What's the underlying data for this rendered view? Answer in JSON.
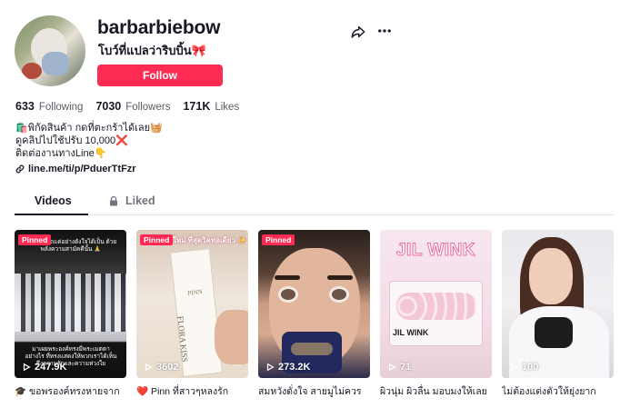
{
  "profile": {
    "username": "barbarbiebow",
    "subtitle": "โบว์ที่แปลว่าริบบิ้น🎀",
    "follow_label": "Follow"
  },
  "stats": [
    {
      "num": "633",
      "label": "Following"
    },
    {
      "num": "7030",
      "label": "Followers"
    },
    {
      "num": "171K",
      "label": "Likes"
    }
  ],
  "bio": {
    "lines": [
      "🛍️พิกัดสินค้า กดที่ตะกร้าได้เลย🧺",
      "ดูคลิปไปใช้ปรับ 10,000❌",
      "ติดต่องานทางLine👇"
    ],
    "link": "line.me/ti/p/PduerTtFzr"
  },
  "tabs": {
    "videos": "Videos",
    "liked": "Liked"
  },
  "videos": [
    {
      "pinned": "Pinned",
      "views": "247.9K",
      "caption": "🎓 ขอพรองค์ทรงหายจาก",
      "overlay_top": "สิ่งนี้ห้ามรถแค่อย่างดังใจได้เป็น ด้วยพลังความสามัคคีนั้น 🙏",
      "overlay_bottom": "มาเผยพระองค์ทรงมีพระเมตตาอย่างไร ที่ทรงแสดงให้พวกเราได้เห็นถึงความรักและความห่วงใย"
    },
    {
      "pinned": "Pinned",
      "views": "3602",
      "caption": "❤️ Pinn ที่สาวๆหลงรัก",
      "overlay_top": "ใหม่ ที่สุดวิคทอเดียว ✨",
      "brand": "PINN",
      "product": "FLORA KISS"
    },
    {
      "pinned": "Pinned",
      "views": "273.2K",
      "caption": "สมหวังดั่งใจ สายมูไม่ควร"
    },
    {
      "pinned": "",
      "views": "71",
      "caption": "ผิวนุ่ม ผิวลื่น มอบมงให้เลย",
      "overlay_top": "JIL WINK",
      "product": "JIL WINK"
    },
    {
      "pinned": "",
      "views": "100",
      "caption": "ไม่ต้องแต่งตัวให้ยุ่งยาก"
    }
  ],
  "colors": {
    "accent": "#fe2c55",
    "text": "#161823",
    "muted": "#73747b"
  }
}
